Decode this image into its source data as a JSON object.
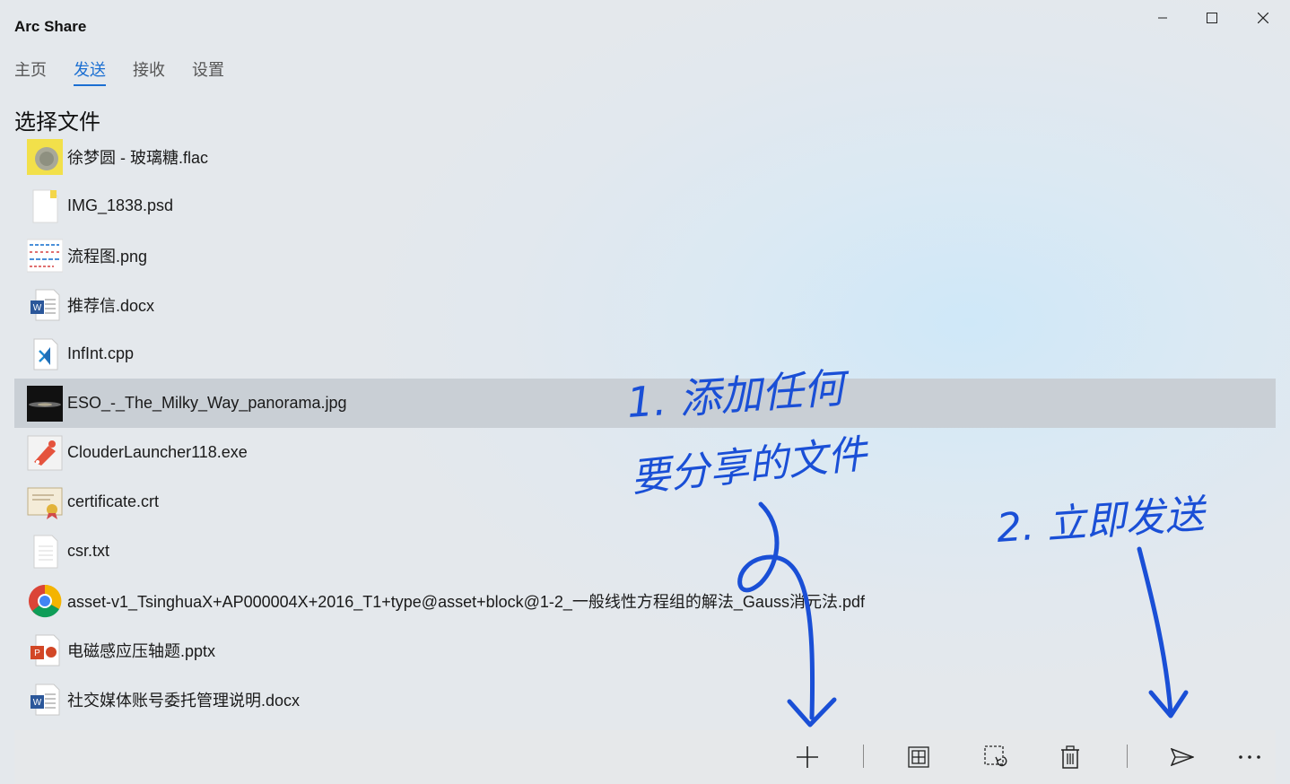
{
  "app": {
    "title": "Arc Share"
  },
  "window_controls": {
    "minimize": "minimize-icon",
    "maximize": "maximize-icon",
    "close": "close-icon"
  },
  "tabs": [
    {
      "label": "主页",
      "active": false
    },
    {
      "label": "发送",
      "active": true
    },
    {
      "label": "接收",
      "active": false
    },
    {
      "label": "设置",
      "active": false
    }
  ],
  "accent_color": "#1b6fd2",
  "section": {
    "title": "选择文件"
  },
  "files": [
    {
      "name": "徐梦圆 - 玻璃糖.flac",
      "icon": "album-art-icon"
    },
    {
      "name": "IMG_1838.psd",
      "icon": "blank-file-icon"
    },
    {
      "name": "流程图.png",
      "icon": "image-thumbnail-icon"
    },
    {
      "name": "推荐信.docx",
      "icon": "word-doc-icon"
    },
    {
      "name": "InfInt.cpp",
      "icon": "vscode-file-icon"
    },
    {
      "name": "ESO_-_The_Milky_Way_panorama.jpg",
      "icon": "photo-thumbnail-icon",
      "selected": true
    },
    {
      "name": "ClouderLauncher118.exe",
      "icon": "app-exe-icon"
    },
    {
      "name": "certificate.crt",
      "icon": "certificate-icon"
    },
    {
      "name": "csr.txt",
      "icon": "text-file-icon"
    },
    {
      "name": "asset-v1_TsinghuaX+AP000004X+2016_T1+type@asset+block@1-2_一般线性方程组的解法_Gauss消元法.pdf",
      "icon": "chrome-pdf-icon"
    },
    {
      "name": "电磁感应压轴题.pptx",
      "icon": "powerpoint-icon"
    },
    {
      "name": "社交媒体账号委托管理说明.docx",
      "icon": "word-doc-icon"
    }
  ],
  "commands": [
    "add-icon",
    "select-all-icon",
    "clear-selection-icon",
    "delete-icon",
    "send-icon",
    "more-icon"
  ],
  "annotations": {
    "note1_line1": "1. 添加任何",
    "note1_line2": "要分享的文件",
    "note2": "2. 立即发送",
    "ink_color": "#1a4fd6"
  }
}
